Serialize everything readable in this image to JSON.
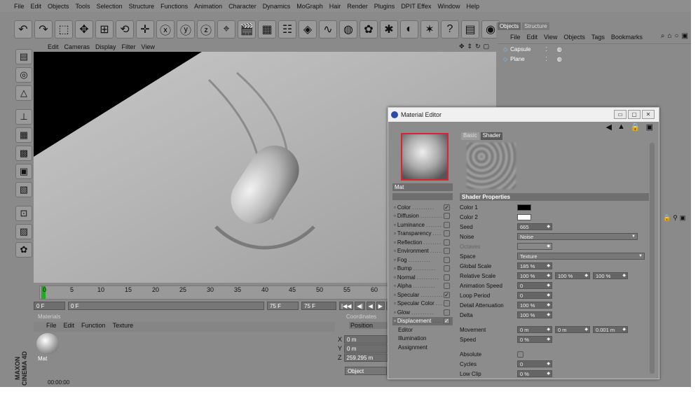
{
  "menubar": [
    "File",
    "Edit",
    "Objects",
    "Tools",
    "Selection",
    "Structure",
    "Functions",
    "Animation",
    "Character",
    "Dynamics",
    "MoGraph",
    "Hair",
    "Render",
    "Plugins",
    "DPIT Effex",
    "Window",
    "Help"
  ],
  "toolbar_icons": [
    "undo-icon",
    "redo-icon",
    "select-icon",
    "move-icon",
    "scale-icon",
    "rotate-icon",
    "live-select-icon",
    "x-axis-icon",
    "y-axis-icon",
    "z-axis-icon",
    "world-coords-icon",
    "render-view-icon",
    "render-picture-viewer-icon",
    "render-settings-icon",
    "cube-icon",
    "spline-icon",
    "nurbs-icon",
    "array-icon",
    "deformer-icon",
    "scene-icon",
    "environment-icon",
    "camera-icon",
    "light-icon",
    "xpresso-icon"
  ],
  "left_tools": [
    "model-mode-icon",
    "object-mode-icon",
    "texture-mode-icon",
    "axis-mode-icon",
    "points-mode-icon",
    "edges-mode-icon",
    "polygons-mode-icon",
    "animation-mode-icon",
    "snap-icon",
    "tweak-icon",
    "sculpt-icon"
  ],
  "viewport": {
    "menu": [
      "Edit",
      "Cameras",
      "Display",
      "Filter",
      "View"
    ]
  },
  "timeline": {
    "ticks": [
      "0",
      "5",
      "10",
      "15",
      "20",
      "25",
      "30",
      "35",
      "40",
      "45",
      "50",
      "55",
      "60"
    ],
    "current_frame": "0 F",
    "start_field": "0 F",
    "end_marker": "75 F",
    "end_field": "75 F",
    "nav_buttons": [
      "|◀◀",
      "◀|",
      "◀",
      "▶",
      "|▶",
      "▶▶|"
    ]
  },
  "materials": {
    "title": "Materials",
    "menu": [
      "File",
      "Edit",
      "Function",
      "Texture"
    ],
    "items": [
      {
        "name": "Mat"
      }
    ]
  },
  "coordinates": {
    "title": "Coordinates",
    "header": "Position",
    "rows": [
      {
        "axis": "X",
        "value": "0 m"
      },
      {
        "axis": "Y",
        "value": "0 m"
      },
      {
        "axis": "Z",
        "value": "259.295 m"
      }
    ],
    "mode": "Object"
  },
  "status": {
    "time": "00:00:00"
  },
  "brand": "MAXON CINEMA 4D",
  "objects_panel": {
    "tabs": [
      "Objects",
      "Structure"
    ],
    "menu": [
      "File",
      "Edit",
      "View",
      "Objects",
      "Tags",
      "Bookmarks"
    ],
    "items": [
      {
        "name": "Capsule"
      },
      {
        "name": "Plane"
      }
    ]
  },
  "material_editor": {
    "title": "Material Editor",
    "material_name": "Mat",
    "tabs": [
      "Basic",
      "Shader"
    ],
    "section": "Shader Properties",
    "channels": [
      {
        "name": "Color",
        "checked": true
      },
      {
        "name": "Diffusion",
        "checked": false
      },
      {
        "name": "Luminance",
        "checked": false
      },
      {
        "name": "Transparency",
        "checked": false
      },
      {
        "name": "Reflection",
        "checked": false
      },
      {
        "name": "Environment",
        "checked": false
      },
      {
        "name": "Fog",
        "checked": false
      },
      {
        "name": "Bump",
        "checked": false
      },
      {
        "name": "Normal",
        "checked": false
      },
      {
        "name": "Alpha",
        "checked": false
      },
      {
        "name": "Specular",
        "checked": true
      },
      {
        "name": "Specular Color",
        "checked": false
      },
      {
        "name": "Glow",
        "checked": false
      },
      {
        "name": "Displacement",
        "checked": true
      }
    ],
    "sub_items": [
      "Editor",
      "Illumination",
      "Assignment"
    ],
    "props": {
      "color1": {
        "label": "Color 1",
        "color": "#000000"
      },
      "color2": {
        "label": "Color 2",
        "color": "#ffffff"
      },
      "seed": {
        "label": "Seed",
        "value": "665"
      },
      "noise": {
        "label": "Noise",
        "value": "Noise"
      },
      "octaves": {
        "label": "Octaves",
        "value": ""
      },
      "space": {
        "label": "Space",
        "value": "Texture"
      },
      "global_scale": {
        "label": "Global Scale",
        "value": "185 %"
      },
      "relative_scale": {
        "label": "Relative Scale",
        "values": [
          "100 %",
          "100 %",
          "100 %"
        ]
      },
      "anim_speed": {
        "label": "Animation Speed",
        "value": "0"
      },
      "loop_period": {
        "label": "Loop Period",
        "value": "0"
      },
      "detail_att": {
        "label": "Detail Attenuation",
        "value": "100 %"
      },
      "delta": {
        "label": "Delta",
        "value": "100 %"
      },
      "movement": {
        "label": "Movement",
        "values": [
          "0 m",
          "0 m",
          "0.001 m"
        ]
      },
      "speed": {
        "label": "Speed",
        "value": "0 %"
      },
      "absolute": {
        "label": "Absolute"
      },
      "cycles": {
        "label": "Cycles",
        "value": "0"
      },
      "low_clip": {
        "label": "Low Clip",
        "value": "0 %"
      }
    }
  }
}
